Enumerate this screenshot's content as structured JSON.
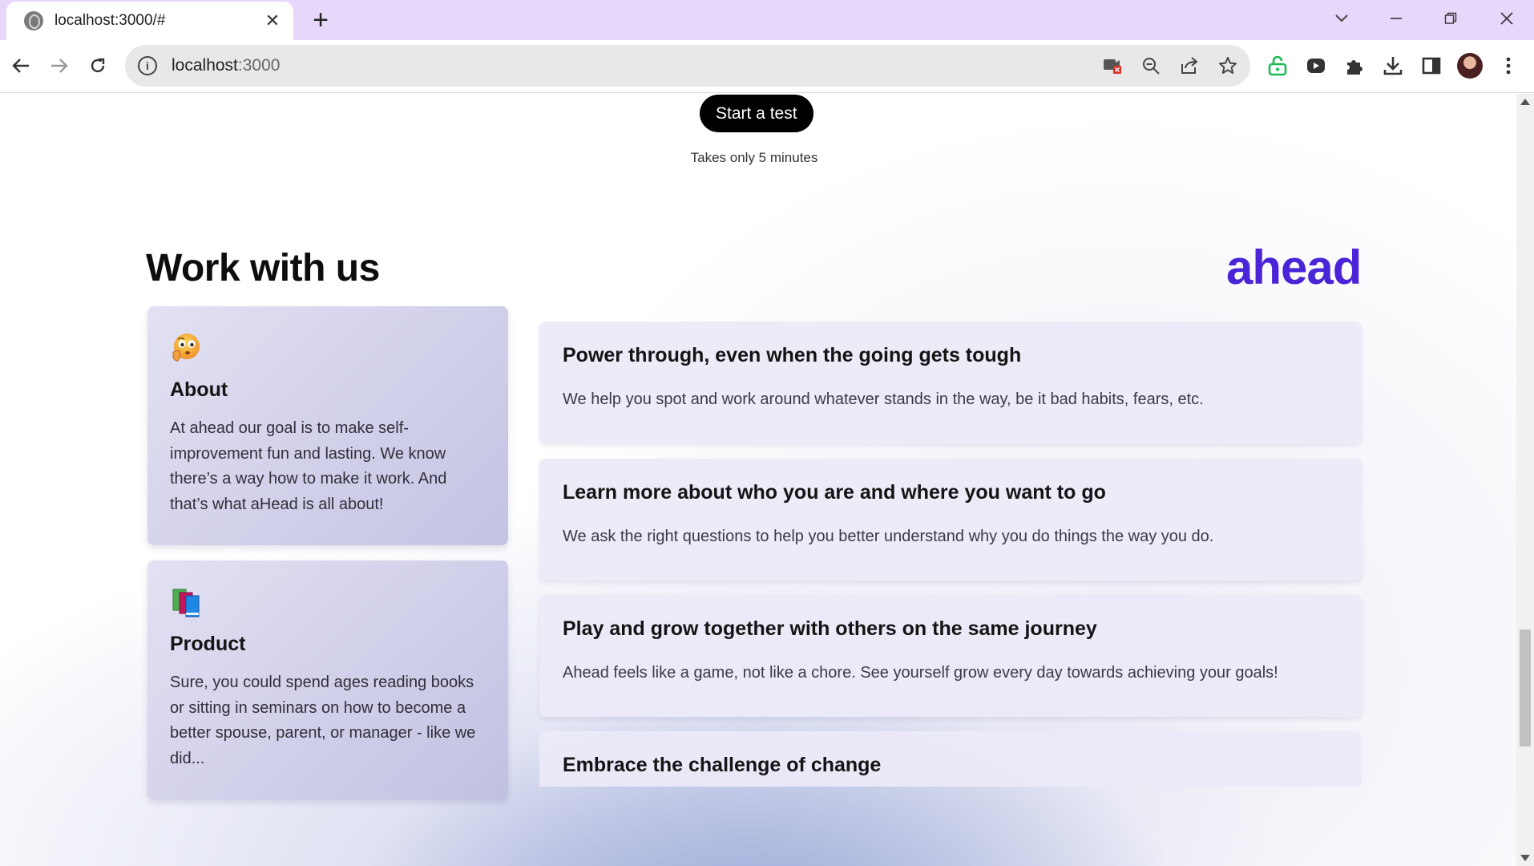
{
  "browser": {
    "tab_title": "localhost:3000/#",
    "url_host": "localhost",
    "url_port": ":3000"
  },
  "page": {
    "cta_label": "Start a test",
    "cta_note": "Takes only 5 minutes",
    "section_title": "Work with us",
    "logo_text": "ahead",
    "info_cards": [
      {
        "icon": "thinking-face-icon",
        "title": "About",
        "text": "At ahead our goal is to make self-improvement fun and lasting. We know there’s a way how to make it work. And that’s what aHead is all about!"
      },
      {
        "icon": "books-icon",
        "title": "Product",
        "text": "Sure, you could spend ages reading books or sitting in seminars on how to become a better spouse, parent, or manager - like we did..."
      }
    ],
    "features": [
      {
        "title": "Power through, even when the going gets tough",
        "text": "We help you spot and work around whatever stands in the way, be it bad habits, fears, etc."
      },
      {
        "title": "Learn more about who you are and where you want to go",
        "text": "We ask the right questions to help you better understand why you do things the way you do."
      },
      {
        "title": "Play and grow together with others on the same journey",
        "text": "Ahead feels like a game, not like a chore. See yourself grow every day towards achieving your goals!"
      },
      {
        "title": "Embrace the challenge of change",
        "text": ""
      }
    ]
  },
  "colors": {
    "tabstrip": "#e7d7fb",
    "brand": "#4a25d8",
    "cta_bg": "#000000"
  }
}
